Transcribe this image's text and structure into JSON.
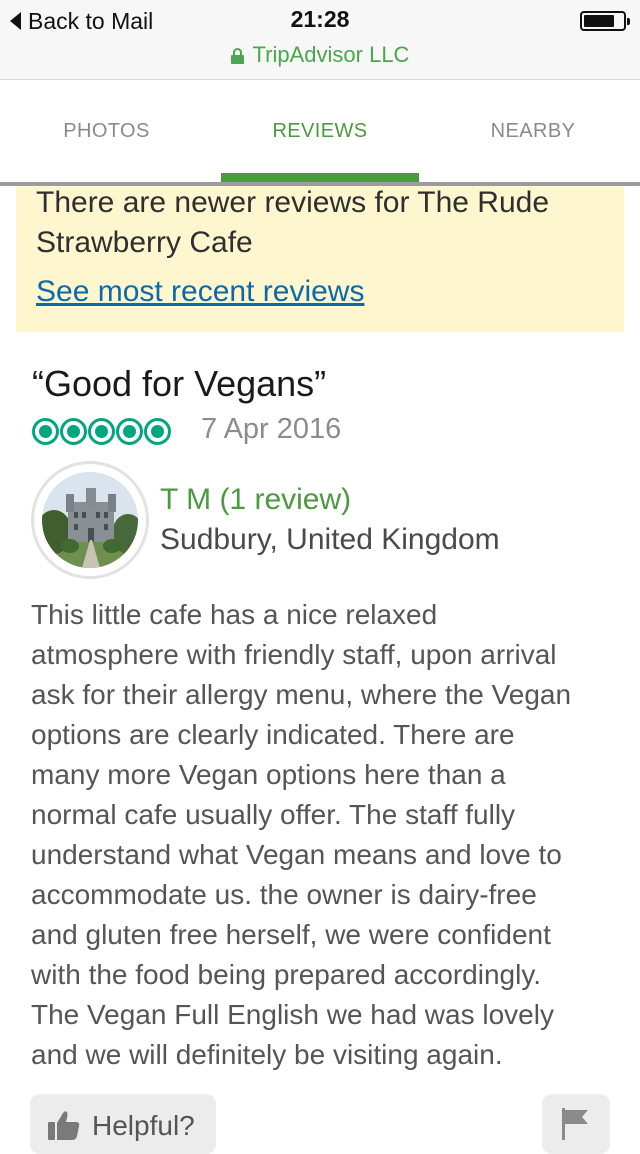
{
  "status_bar": {
    "back_label": "Back to Mail",
    "time": "21:28",
    "site_name": "TripAdvisor LLC",
    "battery_level": 0.75
  },
  "tabs": [
    {
      "label": "PHOTOS",
      "active": false
    },
    {
      "label": "REVIEWS",
      "active": true
    },
    {
      "label": "NEARBY",
      "active": false
    }
  ],
  "notice": {
    "text": "There are newer reviews for The Rude Strawberry Cafe",
    "link": "See most recent reviews"
  },
  "review": {
    "title": "“Good for Vegans”",
    "rating": 5,
    "date": "7 Apr 2016",
    "reviewer": {
      "name": "T M (1 review)",
      "location": "Sudbury, United Kingdom"
    },
    "body_lines": [
      "This little cafe has a nice relaxed",
      "atmosphere with friendly staff, upon arrival",
      "ask for their allergy menu, where the Vegan",
      "options are clearly indicated. There are",
      "many more Vegan options here than a",
      "normal cafe usually offer. The staff fully",
      "understand what Vegan means and love to",
      "accommodate us. the owner is dairy-free",
      "and gluten free herself, we were confident",
      "with the food being prepared accordingly.",
      "The Vegan Full English we had was lovely",
      "and we will definitely be visiting again."
    ]
  },
  "actions": {
    "helpful_label": "Helpful?"
  },
  "colors": {
    "brand_green": "#4b9a3f",
    "rating_green": "#00a680",
    "notice_bg": "#fdf6cf",
    "link_blue": "#0d6aa7"
  }
}
